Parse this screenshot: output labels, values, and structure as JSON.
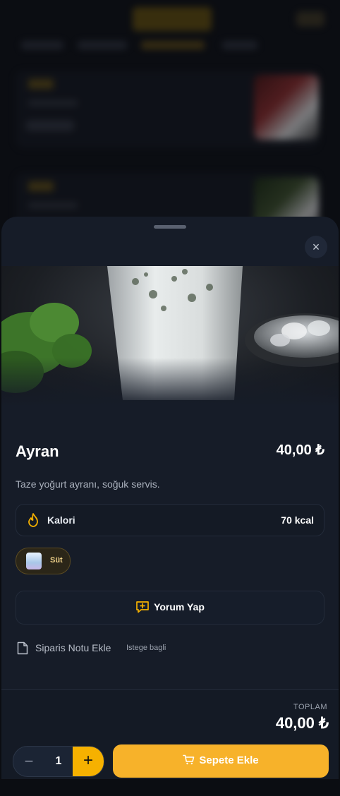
{
  "product": {
    "name": "Ayran",
    "price": "40,00 ₺",
    "description": "Taze yoğurt ayranı, soğuk servis.",
    "image_icon": "ayran-glass-photo"
  },
  "nutrition": {
    "icon": "flame-icon",
    "label": "Kalori",
    "value": "70 kcal"
  },
  "ingredients": [
    {
      "label": "Süt",
      "icon": "milk-glass-icon"
    }
  ],
  "review": {
    "icon": "comment-plus-icon",
    "label": "Yorum Yap"
  },
  "note": {
    "icon": "document-icon",
    "label": "Siparis Notu Ekle",
    "optional": "Istege bagli"
  },
  "footer": {
    "total_label": "TOPLAM",
    "total_value": "40,00 ₺",
    "quantity": "1",
    "minus": "−",
    "plus": "+",
    "add_label": "Sepete Ekle",
    "add_icon": "cart-icon"
  },
  "sheet": {
    "close": "×"
  },
  "colors": {
    "accent": "#f6b100",
    "sheet_bg": "#161c28",
    "chip_text": "#f0d28a"
  }
}
